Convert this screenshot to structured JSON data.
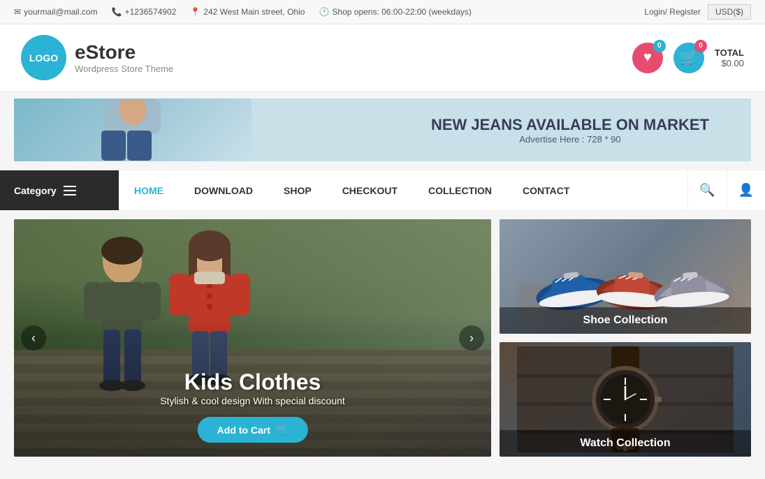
{
  "topbar": {
    "email": "yourmail@mail.com",
    "phone": "+1236574902",
    "address": "242 West Main street, Ohio",
    "hours": "Shop opens: 06:00-22:00 (weekdays)",
    "login": "Login/ Register",
    "currency": "USD($)"
  },
  "header": {
    "logo_text": "LOGO",
    "site_name": "eStore",
    "tagline": "Wordpress Store Theme",
    "wishlist_count": "0",
    "cart_count": "0",
    "total_label": "TOTAL",
    "total_amount": "$0.00"
  },
  "banner": {
    "headline": "NEW JEANS AVAILABLE ON MARKET",
    "subtext": "Advertise Here : 728 * 90"
  },
  "nav": {
    "category_label": "Category",
    "links": [
      {
        "label": "HOME",
        "active": true
      },
      {
        "label": "DOWNLOAD",
        "active": false
      },
      {
        "label": "SHOP",
        "active": false
      },
      {
        "label": "CHECKOUT",
        "active": false
      },
      {
        "label": "COLLECTION",
        "active": false
      },
      {
        "label": "CONTACT",
        "active": false
      }
    ]
  },
  "hero": {
    "title": "Kids Clothes",
    "subtitle": "Stylish & cool design With special discount",
    "cta": "Add to Cart"
  },
  "side_panels": [
    {
      "label": "Shoe Collection"
    },
    {
      "label": "Watch Collection"
    }
  ]
}
